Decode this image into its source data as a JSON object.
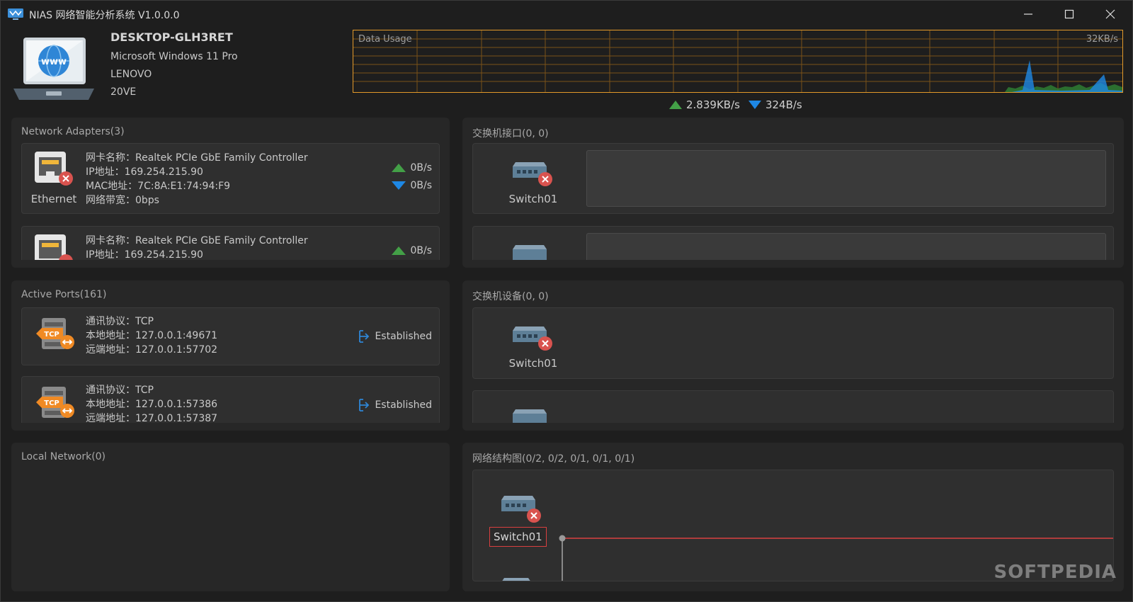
{
  "window": {
    "title": "NIAS 网络智能分析系统  V1.0.0.0",
    "minimize_icon": "minimize-icon",
    "maximize_icon": "maximize-icon",
    "close_icon": "close-icon"
  },
  "host": {
    "name": "DESKTOP-GLH3RET",
    "os": "Microsoft Windows 11 Pro",
    "vendor": "LENOVO",
    "model": "20VE",
    "icon": "laptop-www-icon",
    "icon_text": "www"
  },
  "usage": {
    "label": "Data Usage",
    "max_label": "32KB/s",
    "upload_rate": "2.839KB/s",
    "download_rate": "324B/s",
    "border_color": "#e39a2a",
    "upload_color": "#43a047",
    "download_color": "#1e88e5"
  },
  "adapters": {
    "title": "Network Adapters(3)",
    "items": [
      {
        "name_line": "网卡名称：Realtek PCIe GbE Family Controller",
        "ip_line": "IP地址：169.254.215.90",
        "mac_line": "MAC地址：7C:8A:E1:74:94:F9",
        "bw_line": "网络带宽：0bps",
        "type": "Ethernet",
        "up": "0B/s",
        "down": "0B/s"
      },
      {
        "name_line": "网卡名称：Realtek PCIe GbE Family Controller",
        "ip_line": "IP地址：169.254.215.90",
        "up": "0B/s"
      }
    ]
  },
  "switch_ports": {
    "title": "交换机接口(0, 0)",
    "items": [
      {
        "name": "Switch01"
      }
    ]
  },
  "active_ports": {
    "title": "Active Ports(161)",
    "items": [
      {
        "protocol_line": "通讯协议：TCP",
        "local_line": "本地地址：127.0.0.1:49671",
        "remote_line": "远端地址：127.0.0.1:57702",
        "state": "Established",
        "badge": "TCP"
      },
      {
        "protocol_line": "通讯协议：TCP",
        "local_line": "本地地址：127.0.0.1:57386",
        "remote_line": "远端地址：127.0.0.1:57387",
        "state": "Established",
        "badge": "TCP"
      }
    ]
  },
  "switch_devices": {
    "title": "交换机设备(0, 0)",
    "items": [
      {
        "name": "Switch01"
      }
    ]
  },
  "local_network": {
    "title": "Local Network(0)"
  },
  "topology": {
    "title": "网络结构图(0/2, 0/2, 0/1, 0/1, 0/1)",
    "node": "Switch01",
    "link_color": "#d94040"
  },
  "watermark": "SOFTPEDIA"
}
